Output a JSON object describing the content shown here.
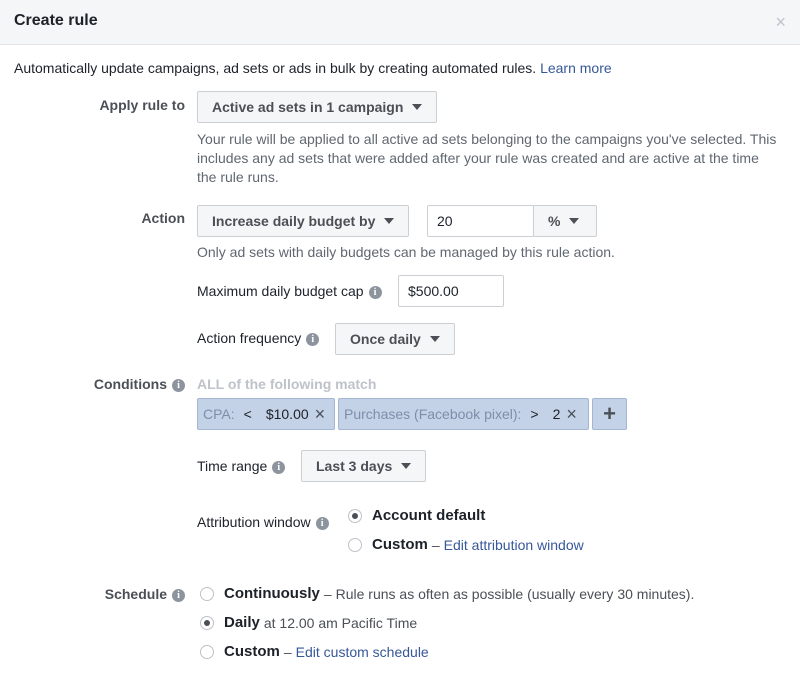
{
  "dialog": {
    "title": "Create rule",
    "close_glyph": "×"
  },
  "intro": {
    "text": "Automatically update campaigns, ad sets or ads in bulk by creating automated rules.",
    "link": "Learn more"
  },
  "apply_rule": {
    "label": "Apply rule to",
    "selected": "Active ad sets in 1 campaign",
    "help_line1": "Your rule will be applied to all active ad sets belonging to the campaigns you've selected. This",
    "help_line2": "includes any ad sets that were added after your rule was created and are active at the time",
    "help_line3": "the rule runs."
  },
  "action": {
    "label": "Action",
    "selected": "Increase daily budget by",
    "amount": "20",
    "unit": "%",
    "help": "Only ad sets with daily budgets can be managed by this rule action.",
    "max_cap_label": "Maximum daily budget cap",
    "max_cap_value": "$500.00",
    "frequency_label": "Action frequency",
    "frequency_selected": "Once daily"
  },
  "conditions": {
    "label": "Conditions",
    "group_title": "ALL of the following match",
    "chips": [
      {
        "metric": "CPA:",
        "operator": "<",
        "value": "$10.00"
      },
      {
        "metric": "Purchases (Facebook pixel):",
        "operator": ">",
        "value": "2"
      }
    ],
    "add_glyph": "+",
    "time_range_label": "Time range",
    "time_range_selected": "Last 3 days",
    "attribution_label": "Attribution window",
    "attribution_options": [
      {
        "label": "Account default",
        "selected": true
      },
      {
        "label": "Custom",
        "separator": "–",
        "link": "Edit attribution window",
        "selected": false
      }
    ]
  },
  "schedule": {
    "label": "Schedule",
    "options": [
      {
        "label": "Continuously",
        "separator": "–",
        "desc": "Rule runs as often as possible (usually every 30 minutes).",
        "selected": false
      },
      {
        "label": "Daily",
        "desc": "at 12.00 am Pacific Time",
        "selected": true
      },
      {
        "label": "Custom",
        "separator": "–",
        "link": "Edit custom schedule",
        "selected": false
      }
    ]
  },
  "icons": {
    "info": "info-icon",
    "caret": "caret-down-icon",
    "close": "close-icon",
    "remove": "remove-icon",
    "plus": "plus-icon"
  },
  "colors": {
    "link": "#365899",
    "chip_bg": "#c4d2e7",
    "header_bg": "#f5f6f7"
  }
}
